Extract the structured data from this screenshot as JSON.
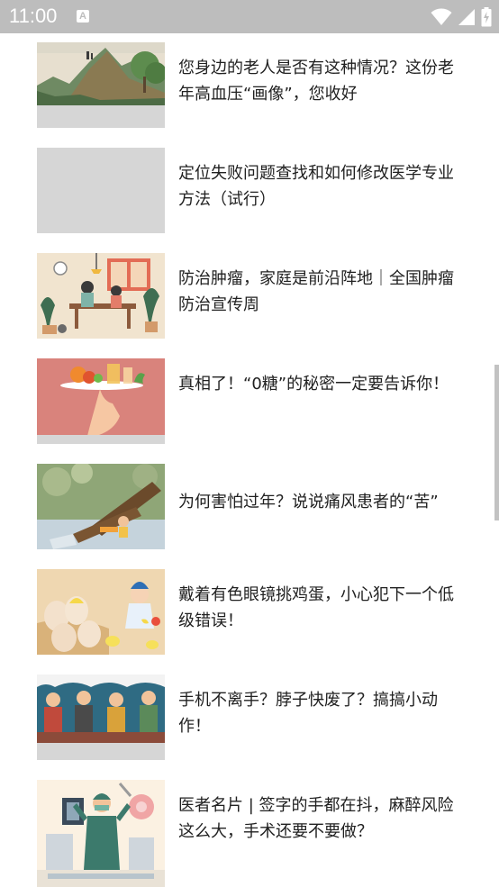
{
  "status_bar": {
    "time": "11:00",
    "notification_badge": "A",
    "icons": [
      "wifi-icon",
      "cellular-signal-icon",
      "battery-icon"
    ]
  },
  "articles": [
    {
      "title": "您身边的老人是否有这种情况？这份老年高血压“画像”，您收好",
      "thumbnail": "mountain-landscape-illustration"
    },
    {
      "title": "定位失败问题查找和如何修改医学专业方法（试行）",
      "thumbnail": "placeholder"
    },
    {
      "title": "防治肿瘤，家庭是前沿阵地｜全国肿瘤防治宣传周",
      "thumbnail": "family-dinner-illustration"
    },
    {
      "title": "真相了！“0糖”的秘密一定要告诉你！",
      "thumbnail": "food-tray-illustration"
    },
    {
      "title": "为何害怕过年？说说痛风患者的“苦”",
      "thumbnail": "beer-bottles-illustration"
    },
    {
      "title": "戴着有色眼镜挑鸡蛋，小心犯下一个低级错误！",
      "thumbnail": "eggs-chicks-illustration"
    },
    {
      "title": "手机不离手？脖子快废了？搞搞小动作！",
      "thumbnail": "people-on-phones-illustration"
    },
    {
      "title": "医者名片 | 签字的手都在抖，麻醉风险这么大，手术还要不要做？",
      "thumbnail": "anesthesiologist-illustration"
    }
  ]
}
